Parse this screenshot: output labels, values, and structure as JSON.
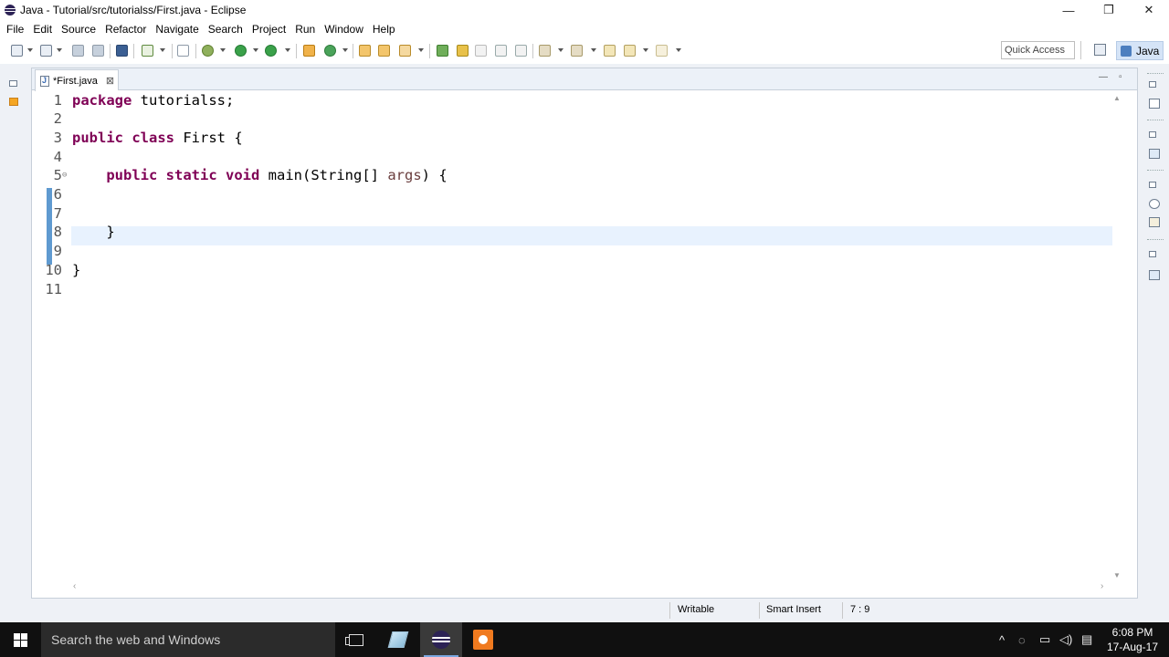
{
  "window": {
    "title": "Java - Tutorial/src/tutorialss/First.java - Eclipse",
    "minimize_glyph": "—",
    "maximize_glyph": "❐",
    "close_glyph": "✕"
  },
  "menu": [
    "File",
    "Edit",
    "Source",
    "Refactor",
    "Navigate",
    "Search",
    "Project",
    "Run",
    "Window",
    "Help"
  ],
  "toolbar": {
    "quick_access_placeholder": "Quick Access",
    "perspective_label": "Java"
  },
  "editor": {
    "tab_label": "*First.java",
    "tab_close_glyph": "⊠",
    "minimize_glyph": "—",
    "maximize_glyph": "▫",
    "lines": [
      {
        "n": "1",
        "parts": [
          {
            "t": "package",
            "c": "kw"
          },
          {
            "t": " tutorialss;",
            "c": ""
          }
        ]
      },
      {
        "n": "2",
        "parts": []
      },
      {
        "n": "3",
        "parts": [
          {
            "t": "public",
            "c": "kw"
          },
          {
            "t": " ",
            "c": ""
          },
          {
            "t": "class",
            "c": "kw"
          },
          {
            "t": " First {",
            "c": ""
          }
        ]
      },
      {
        "n": "4",
        "parts": []
      },
      {
        "n": "5",
        "parts": [
          {
            "t": "    ",
            "c": ""
          },
          {
            "t": "public",
            "c": "kw"
          },
          {
            "t": " ",
            "c": ""
          },
          {
            "t": "static",
            "c": "kw"
          },
          {
            "t": " ",
            "c": ""
          },
          {
            "t": "void",
            "c": "kw"
          },
          {
            "t": " main(String[] ",
            "c": ""
          },
          {
            "t": "args",
            "c": "param"
          },
          {
            "t": ") {",
            "c": ""
          }
        ]
      },
      {
        "n": "6",
        "parts": []
      },
      {
        "n": "7",
        "parts": []
      },
      {
        "n": "8",
        "parts": [
          {
            "t": "    }",
            "c": ""
          }
        ]
      },
      {
        "n": "9",
        "parts": []
      },
      {
        "n": "10",
        "parts": [
          {
            "t": "}",
            "c": ""
          }
        ]
      },
      {
        "n": "11",
        "parts": []
      }
    ]
  },
  "status": {
    "writable": "Writable",
    "insert_mode": "Smart Insert",
    "position": "7 : 9"
  },
  "taskbar": {
    "search_placeholder": "Search the web and Windows",
    "time": "6:08 PM",
    "date": "17-Aug-17"
  },
  "colors": {
    "keyword": "#7f0055",
    "current_line": "#e8f2fe",
    "change_bar": "#5f9ad0"
  }
}
